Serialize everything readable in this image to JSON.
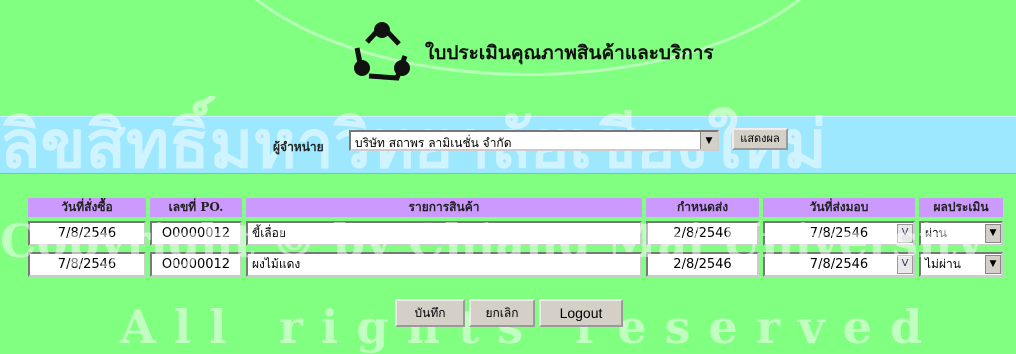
{
  "header": {
    "title": "ใบประเมินคุณภาพสินค้าและบริการ",
    "logo_icon": "three-circles-logo-icon"
  },
  "vendor": {
    "label": "ผู้จำหน่าย",
    "selected": "บริษัท สถาพร ลามิเนชั่น จำกัด",
    "show_button": "แสดงผล"
  },
  "table": {
    "headers": [
      "วันที่สั่งซื้อ",
      "เลขที่ PO.",
      "รายการสินค้า",
      "กำหนดส่ง",
      "วันที่ส่งมอบ",
      "ผลประเมิน"
    ],
    "rows": [
      {
        "order_date": "7/8/2546",
        "po": "O0000012",
        "item": "ขี้เลื่อย",
        "due": "2/8/2546",
        "delivered": "7/8/2546",
        "result": "ผ่าน"
      },
      {
        "order_date": "7/8/2546",
        "po": "O0000012",
        "item": "ผงไม้แดง",
        "due": "2/8/2546",
        "delivered": "7/8/2546",
        "result": "ไม่ผ่าน"
      }
    ]
  },
  "buttons": {
    "save": "บันทึก",
    "cancel": "ยกเลิก",
    "logout": "Logout"
  },
  "watermark": {
    "line1": "ลิขสิทธิ์มหาวิทยาลัยเชียงใหม่",
    "line2": "Copyright © by Chiang Mai University",
    "line3": "All rights reserved"
  },
  "colors": {
    "background": "#80ff80",
    "vendor_bar": "#9ee8ff",
    "header_cell": "#cc99ff"
  }
}
